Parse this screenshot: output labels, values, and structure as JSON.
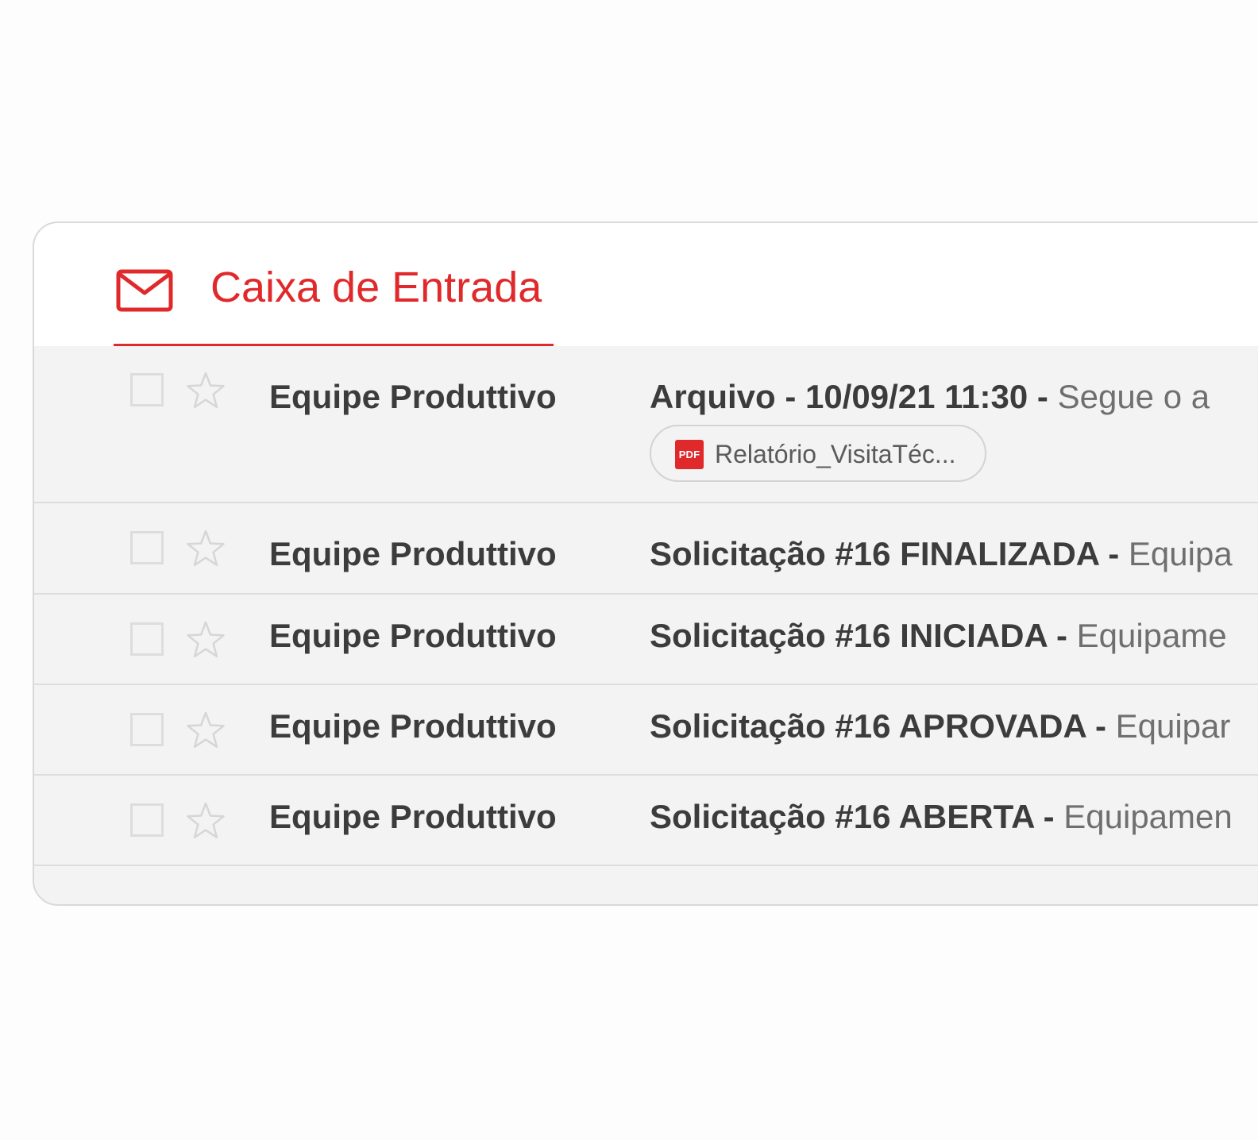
{
  "inbox": {
    "tab_label": "Caixa de Entrada",
    "tab_icon": "mail-icon",
    "accent_color": "#e0292b"
  },
  "emails": [
    {
      "sender": "Equipe Produttivo",
      "subject": "Arquivo - 10/09/21 11:30",
      "separator": " - ",
      "snippet": "Segue o a",
      "attachment": {
        "icon_label": "PDF",
        "name": "Relatório_VisitaTéc..."
      }
    },
    {
      "sender": "Equipe Produttivo",
      "subject": "Solicitação #16 FINALIZADA",
      "separator": " - ",
      "snippet": "Equipa"
    },
    {
      "sender": "Equipe Produttivo",
      "subject": "Solicitação #16 INICIADA",
      "separator": " - ",
      "snippet": "Equipame"
    },
    {
      "sender": "Equipe Produttivo",
      "subject": "Solicitação #16 APROVADA",
      "separator": " - ",
      "snippet": "Equipar"
    },
    {
      "sender": "Equipe Produttivo",
      "subject": "Solicitação #16 ABERTA",
      "separator": " - ",
      "snippet": "Equipamen"
    }
  ]
}
